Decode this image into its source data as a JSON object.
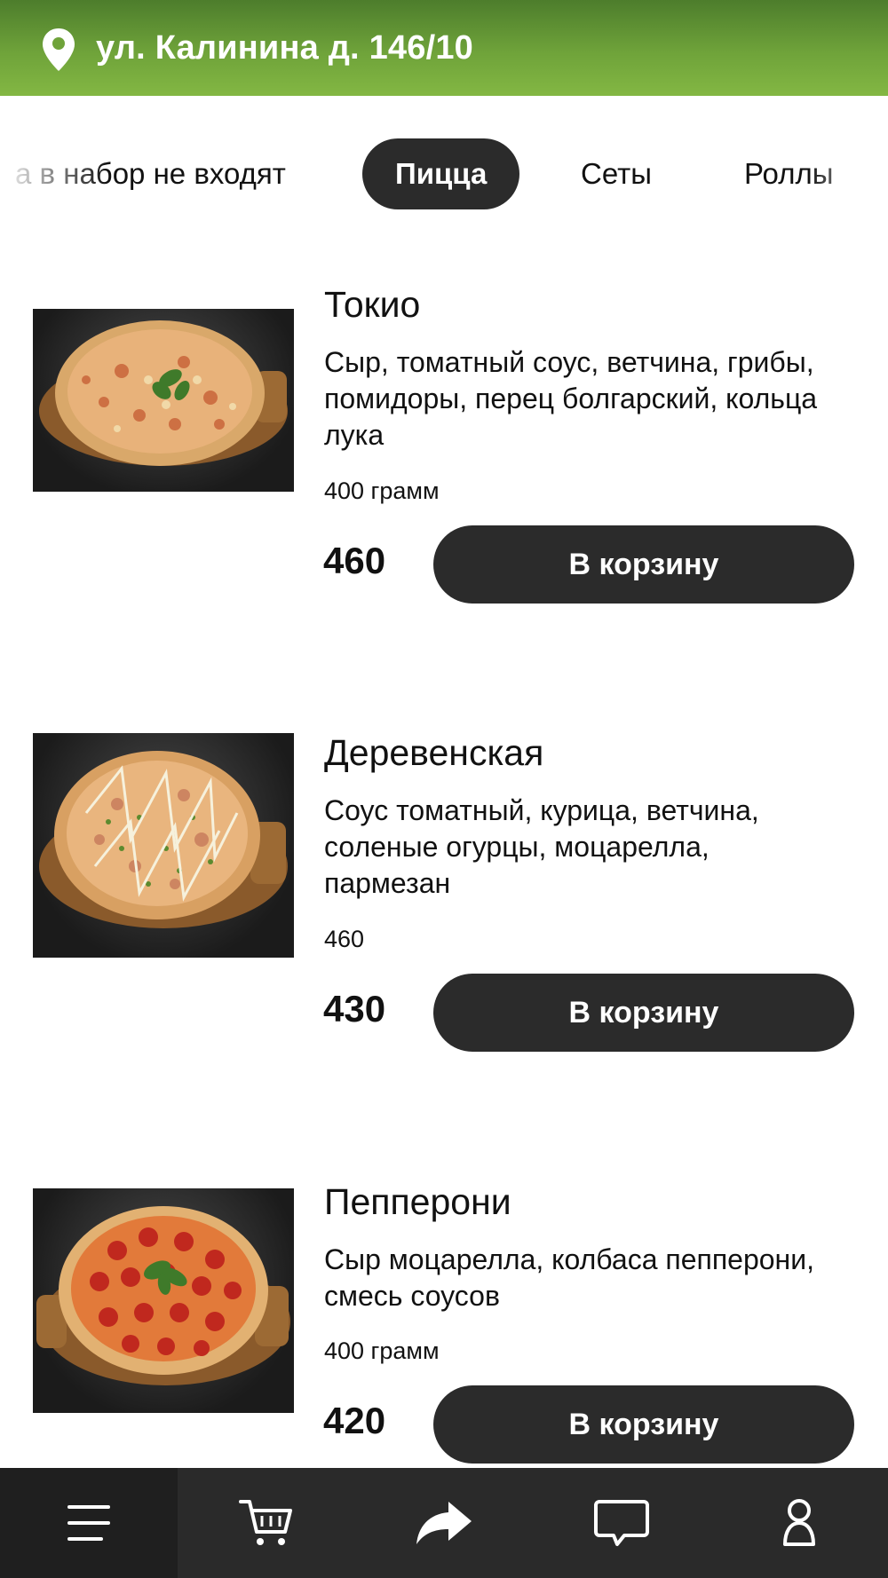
{
  "header": {
    "address": "ул. Калинина д. 146/10",
    "icon": "location-pin-icon"
  },
  "colors": {
    "header_green": "#6fa33a",
    "dark": "#2b2b2b",
    "white": "#ffffff"
  },
  "tabs": [
    {
      "label": "а в набор не входят",
      "active": false
    },
    {
      "label": "Пицца",
      "active": true
    },
    {
      "label": "Сеты",
      "active": false
    },
    {
      "label": "Роллы",
      "active": false
    }
  ],
  "products": [
    {
      "title": "Токио",
      "description": "Сыр, томатный соус, ветчина, грибы, помидоры, перец болгарский, кольца лука",
      "weight": "400 грамм",
      "price": "460",
      "button": "В корзину"
    },
    {
      "title": "Деревенская",
      "description": "Соус томатный, курица, ветчина, соленые огурцы, моцарелла, пармезан",
      "weight": "460",
      "price": "430",
      "button": "В корзину"
    },
    {
      "title": "Пепперони",
      "description": "Сыр моцарелла, колбаса пепперони, смесь соусов",
      "weight": "400 грамм",
      "price": "420",
      "button": "В корзину"
    }
  ],
  "bottom_nav": [
    {
      "icon": "menu-icon",
      "active": true
    },
    {
      "icon": "cart-icon",
      "active": false
    },
    {
      "icon": "share-icon",
      "active": false
    },
    {
      "icon": "chat-icon",
      "active": false
    },
    {
      "icon": "profile-icon",
      "active": false
    }
  ]
}
